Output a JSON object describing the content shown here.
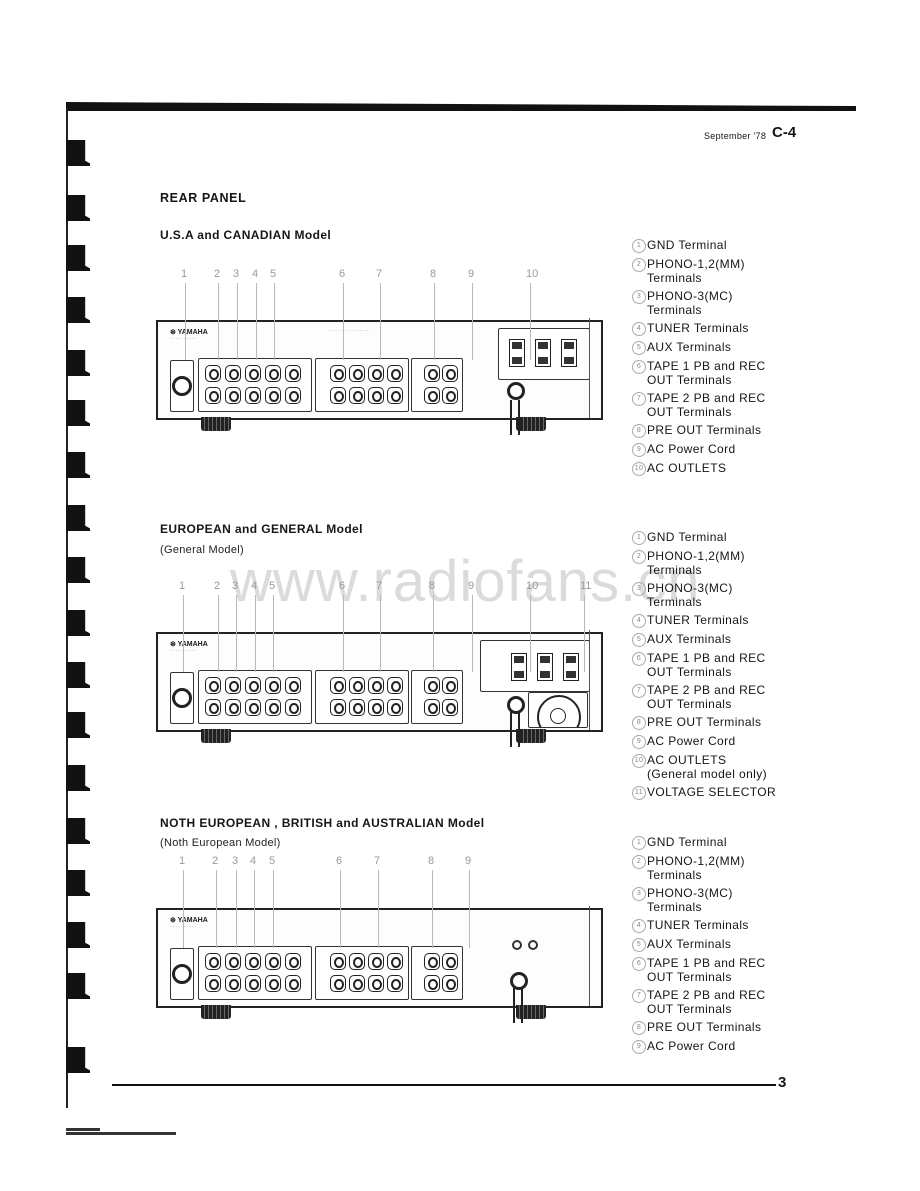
{
  "header": {
    "date": "September '78",
    "code": "C-4"
  },
  "page_title": "REAR PANEL",
  "watermark": "www.radiofans.cn",
  "page_number": "3",
  "sections": [
    {
      "title": "U.S.A and CANADIAN Model",
      "subtitle": "",
      "callouts": [
        "1",
        "2",
        "3",
        "4",
        "5",
        "6",
        "7",
        "8",
        "9",
        "10"
      ],
      "legend": [
        {
          "n": "1",
          "text": "GND Terminal"
        },
        {
          "n": "2",
          "text": "PHONO-1,2(MM)\nTerminals"
        },
        {
          "n": "3",
          "text": "PHONO-3(MC)\nTerminals"
        },
        {
          "n": "4",
          "text": "TUNER Terminals"
        },
        {
          "n": "5",
          "text": "AUX Terminals"
        },
        {
          "n": "6",
          "text": "TAPE 1 PB and REC\nOUT Terminals"
        },
        {
          "n": "7",
          "text": "TAPE 2 PB and REC\nOUT Terminals"
        },
        {
          "n": "8",
          "text": "PRE OUT Terminals"
        },
        {
          "n": "9",
          "text": "AC Power Cord"
        },
        {
          "n": "10",
          "text": "AC OUTLETS"
        }
      ],
      "panel": {
        "brand": "YAMAHA",
        "outlets_label": "AC OUTLETS"
      }
    },
    {
      "title": "EUROPEAN and GENERAL Model",
      "subtitle": "(General Model)",
      "callouts": [
        "1",
        "2",
        "3",
        "4",
        "5",
        "6",
        "7",
        "8",
        "9",
        "10",
        "11"
      ],
      "legend": [
        {
          "n": "1",
          "text": "GND Terminal"
        },
        {
          "n": "2",
          "text": "PHONO-1,2(MM)\nTerminals"
        },
        {
          "n": "3",
          "text": "PHONO-3(MC)\nTerminals"
        },
        {
          "n": "4",
          "text": "TUNER Terminals"
        },
        {
          "n": "5",
          "text": "AUX Terminals"
        },
        {
          "n": "6",
          "text": "TAPE 1 PB and REC\nOUT Terminals"
        },
        {
          "n": "7",
          "text": "TAPE 2 PB and REC\nOUT Terminals"
        },
        {
          "n": "8",
          "text": "PRE OUT Terminals"
        },
        {
          "n": "9",
          "text": "AC Power Cord"
        },
        {
          "n": "10",
          "text": "AC OUTLETS\n(General model only)"
        },
        {
          "n": "11",
          "text": "VOLTAGE SELECTOR"
        }
      ],
      "panel": {
        "brand": "YAMAHA",
        "outlets_label": "AC OUTLETS",
        "voltage_label": "VOLTAGE SELECTOR"
      }
    },
    {
      "title": "NOTH EUROPEAN , BRITISH and AUSTRALIAN Model",
      "subtitle": "(Noth European Model)",
      "callouts": [
        "1",
        "2",
        "3",
        "4",
        "5",
        "6",
        "7",
        "8",
        "9"
      ],
      "legend": [
        {
          "n": "1",
          "text": "GND Terminal"
        },
        {
          "n": "2",
          "text": "PHONO-1,2(MM)\nTerminals"
        },
        {
          "n": "3",
          "text": "PHONO-3(MC)\nTerminals"
        },
        {
          "n": "4",
          "text": "TUNER Terminals"
        },
        {
          "n": "5",
          "text": "AUX Terminals"
        },
        {
          "n": "6",
          "text": "TAPE 1 PB and REC\nOUT Terminals"
        },
        {
          "n": "7",
          "text": "TAPE 2 PB and REC\nOUT Terminals"
        },
        {
          "n": "8",
          "text": "PRE OUT Terminals"
        },
        {
          "n": "9",
          "text": "AC Power Cord"
        }
      ],
      "panel": {
        "brand": "YAMAHA"
      }
    }
  ]
}
